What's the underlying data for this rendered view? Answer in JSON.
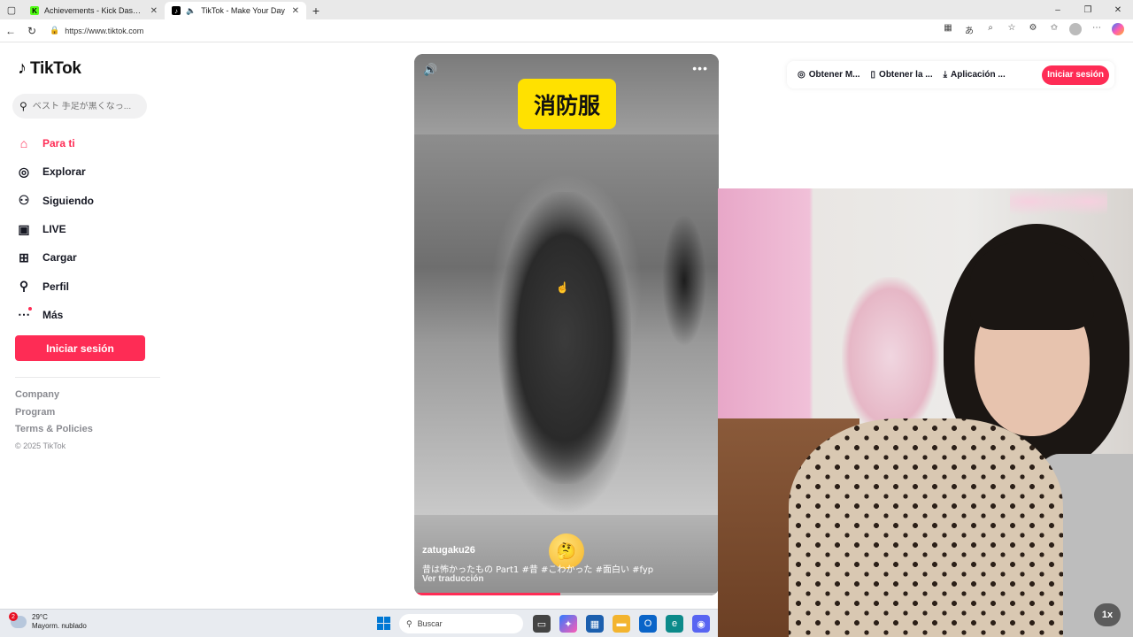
{
  "browser": {
    "tabs": [
      {
        "title": "Achievements - Kick Dashboard",
        "favicon": "kick-icon"
      },
      {
        "title": "TikTok - Make Your Day",
        "favicon": "tiktok-icon"
      }
    ],
    "url": "https://www.tiktok.com"
  },
  "brand": {
    "name": "TikTok",
    "accent": "#fe2c55"
  },
  "search": {
    "placeholder": "ベスト 手足が黒くなっ..."
  },
  "nav": [
    {
      "label": "Para ti",
      "icon": "home-icon",
      "active": true
    },
    {
      "label": "Explorar",
      "icon": "compass-icon"
    },
    {
      "label": "Siguiendo",
      "icon": "following-icon"
    },
    {
      "label": "LIVE",
      "icon": "live-icon"
    },
    {
      "label": "Cargar",
      "icon": "upload-icon"
    },
    {
      "label": "Perfil",
      "icon": "profile-icon"
    },
    {
      "label": "Más",
      "icon": "more-icon"
    }
  ],
  "login_label": "Iniciar sesión",
  "footer": {
    "links": [
      "Company",
      "Program",
      "Terms & Policies"
    ],
    "copyright": "© 2025 TikTok"
  },
  "video": {
    "overlay_title": "消防服",
    "author": "zatugaku26",
    "caption": "昔は怖かったもの Part1 #昔  #こわかった  #面白い  #fyp",
    "translate": "Ver traducción",
    "emoji": "🤔",
    "progress": 0.48
  },
  "topbar": {
    "items": [
      {
        "label": "Obtener M...",
        "icon": "coin-icon"
      },
      {
        "label": "Obtener la ...",
        "icon": "phone-icon"
      },
      {
        "label": "Aplicación ...",
        "icon": "download-icon"
      }
    ],
    "login_label": "Iniciar sesión"
  },
  "webcam": {
    "speed_label": "1x"
  },
  "taskbar": {
    "weather_badge": "2",
    "temperature": "29°C",
    "weather_desc": "Mayorm. nublado",
    "search_label": "Buscar"
  }
}
